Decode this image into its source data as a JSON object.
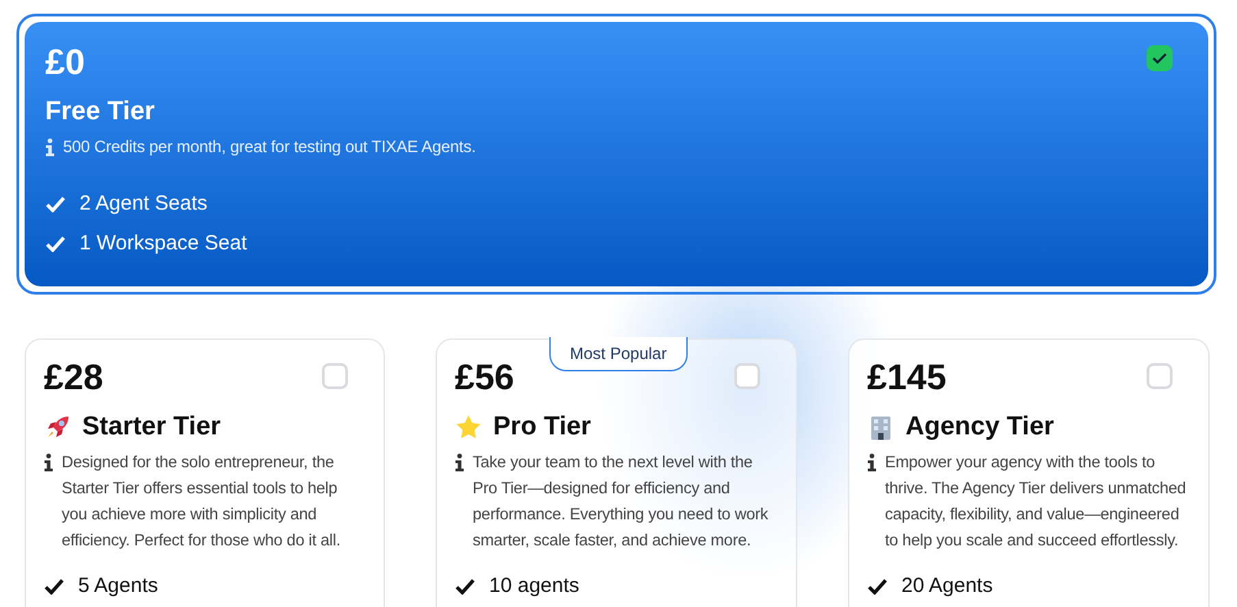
{
  "plans": [
    {
      "kind": "free",
      "price": "£0",
      "title": "Free Tier",
      "selected": true,
      "description": "500 Credits per month, great for testing out TIXAE Agents.",
      "features": [
        "2 Agent Seats",
        "1 Workspace Seat"
      ]
    },
    {
      "kind": "starter",
      "price": "£28",
      "title": "Starter Tier",
      "selected": false,
      "description": "Designed for the solo entrepreneur, the Starter Tier offers essential tools to help you achieve more with simplicity and efficiency. Perfect for those who do it all.",
      "features": [
        "5 Agents"
      ]
    },
    {
      "kind": "pro",
      "price": "£56",
      "title": "Pro Tier",
      "selected": false,
      "badge": "Most Popular",
      "description": "Take your team to the next level with the Pro Tier—designed for efficiency and performance. Everything you need to work smarter, scale faster, and achieve more.",
      "features": [
        "10 agents"
      ]
    },
    {
      "kind": "agency",
      "price": "£145",
      "title": "Agency Tier",
      "selected": false,
      "description": "Empower your agency with the tools to thrive. The Agency Tier delivers unmatched capacity, flexibility, and value—engineered to help you scale and succeed effortlessly.",
      "features": [
        "20 Agents"
      ]
    }
  ]
}
